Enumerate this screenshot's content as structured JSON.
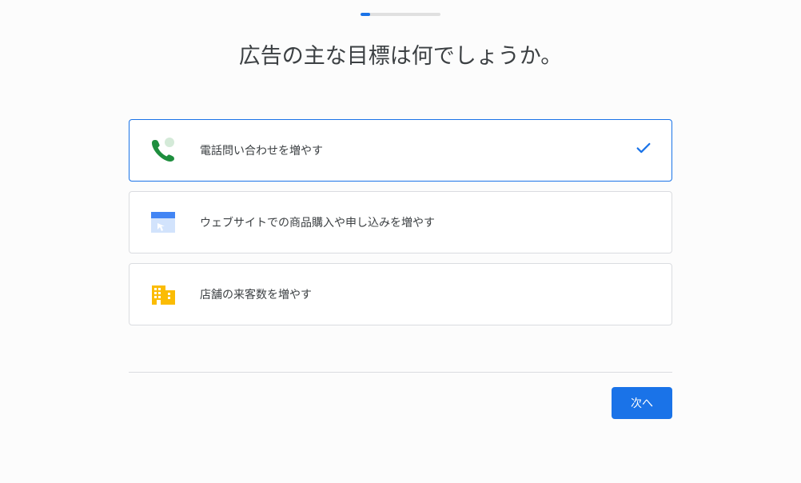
{
  "title": "広告の主な目標は何でしょうか。",
  "options": [
    {
      "label": "電話問い合わせを増やす",
      "selected": true
    },
    {
      "label": "ウェブサイトでの商品購入や申し込みを増やす",
      "selected": false
    },
    {
      "label": "店舗の来客数を増やす",
      "selected": false
    }
  ],
  "buttons": {
    "next": "次へ"
  },
  "progress": {
    "percent": 12
  }
}
